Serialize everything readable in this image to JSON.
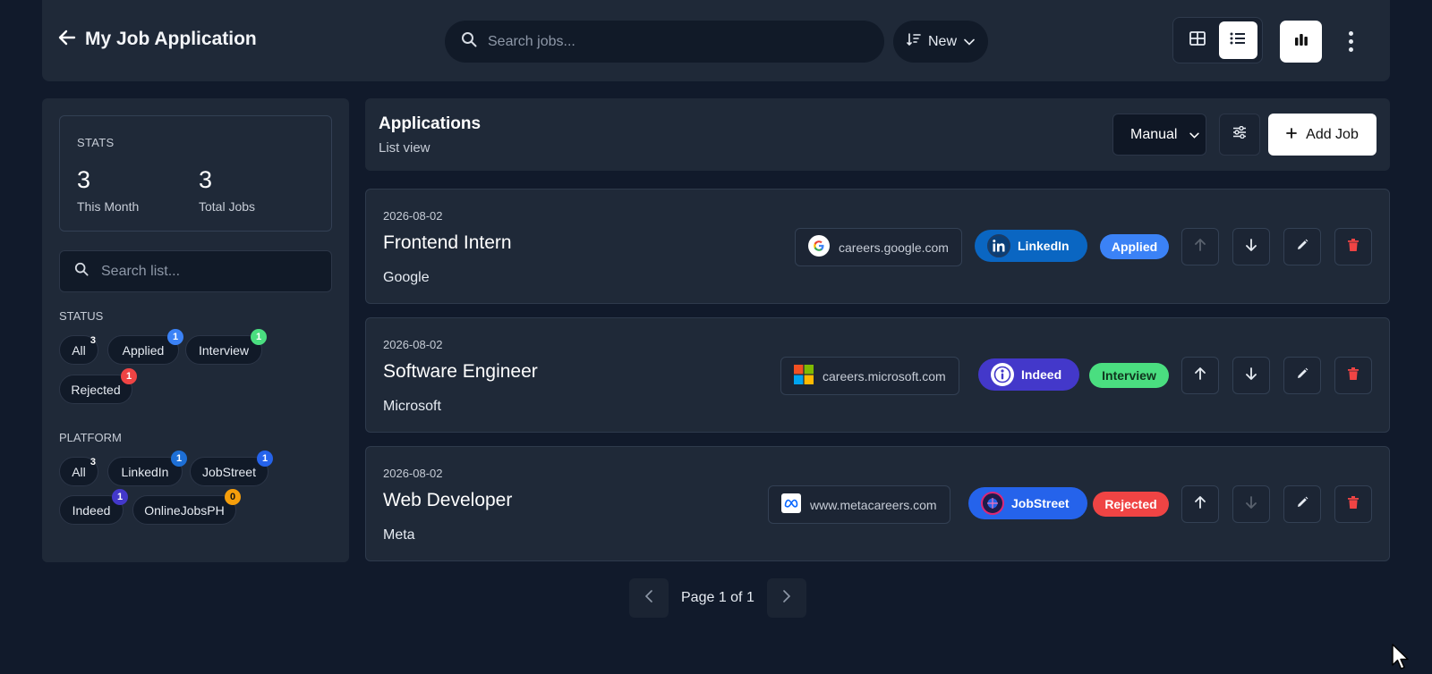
{
  "header": {
    "title": "My Job Application",
    "search_placeholder": "Search jobs...",
    "sort_label": "New"
  },
  "sidebar": {
    "stats_label": "STATS",
    "stats": [
      {
        "value": "3",
        "label": "This Month"
      },
      {
        "value": "3",
        "label": "Total Jobs"
      }
    ],
    "search_placeholder": "Search list...",
    "status_label": "STATUS",
    "status_filters": [
      {
        "label": "All",
        "count": "3"
      },
      {
        "label": "Applied",
        "count": "1"
      },
      {
        "label": "Interview",
        "count": "1"
      },
      {
        "label": "Rejected",
        "count": "1"
      }
    ],
    "platform_label": "PLATFORM",
    "platform_filters": [
      {
        "label": "All",
        "count": "3"
      },
      {
        "label": "LinkedIn",
        "count": "1"
      },
      {
        "label": "JobStreet",
        "count": "1"
      },
      {
        "label": "Indeed",
        "count": "1"
      },
      {
        "label": "OnlineJobsPH",
        "count": "0"
      }
    ]
  },
  "applications": {
    "title": "Applications",
    "subtitle": "List view",
    "mode": "Manual",
    "add_label": "Add Job",
    "jobs": [
      {
        "date": "2026-08-02",
        "role": "Frontend Intern",
        "company": "Google",
        "site": "careers.google.com",
        "platform": "LinkedIn",
        "status": "Applied"
      },
      {
        "date": "2026-08-02",
        "role": "Software Engineer",
        "company": "Microsoft",
        "site": "careers.microsoft.com",
        "platform": "Indeed",
        "status": "Interview"
      },
      {
        "date": "2026-08-02",
        "role": "Web Developer",
        "company": "Meta",
        "site": "www.metacareers.com",
        "platform": "JobStreet",
        "status": "Rejected"
      }
    ]
  },
  "pagination": {
    "text": "Page 1 of 1"
  },
  "colors": {
    "applied": "#3b82f6",
    "interview": "#4ade80",
    "rejected": "#ef4444",
    "linkedin": "#0a66c2",
    "indeed": "#4338ca",
    "jobstreet": "#2563eb"
  }
}
